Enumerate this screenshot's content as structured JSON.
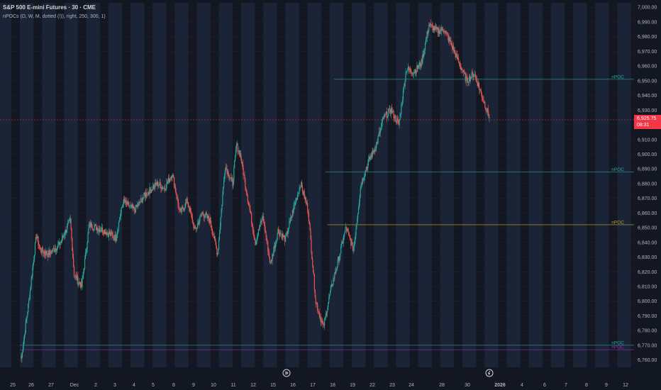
{
  "header": {
    "title": "S&P 500 E-mini Futures · 30 · CME",
    "indicator": "nPOCs (D, W, M, dotted (!)), right, 250, 300, 1)"
  },
  "price_tag": {
    "price": "6,925.75",
    "countdown": "08:31"
  },
  "colors": {
    "background": "#131722",
    "shade": "#1b2436",
    "up": "#26a69a",
    "down": "#ef5350",
    "grid": "#1e222d",
    "axis_text": "#b2b5be",
    "current_price": "#f23645",
    "npoc_daily": "#26a69a",
    "npoc_weekly": "#b0a030",
    "npoc_monthly": "#9c27b0"
  },
  "icons": [
    "replay-icon",
    "flash-icon"
  ],
  "chart_data": {
    "type": "candlestick",
    "title": "S&P 500 E-mini Futures · 30 · CME",
    "ylim": [
      6755,
      7003
    ],
    "y_ticks": [
      6760,
      6770,
      6780,
      6790,
      6800,
      6810,
      6820,
      6830,
      6840,
      6850,
      6860,
      6870,
      6880,
      6890,
      6900,
      6910,
      6920,
      6930,
      6940,
      6950,
      6960,
      6970,
      6980,
      6990,
      7000
    ],
    "y_tick_labels": [
      "6,760.00",
      "6,770.00",
      "6,780.00",
      "6,790.00",
      "6,800.00",
      "6,810.00",
      "6,820.00",
      "6,830.00",
      "6,840.00",
      "6,850.00",
      "6,860.00",
      "6,870.00",
      "6,880.00",
      "6,890.00",
      "6,900.00",
      "6,910.00",
      "6,920.00",
      "6,930.00",
      "6,940.00",
      "6,950.00",
      "6,960.00",
      "6,970.00",
      "6,980.00",
      "6,990.00",
      "7,000.00"
    ],
    "x_labels": [
      "25",
      "26",
      "27",
      "Dec",
      "2",
      "3",
      "4",
      "5",
      "8",
      "9",
      "10",
      "11",
      "12",
      "15",
      "16",
      "17",
      "18",
      "19",
      "22",
      "23",
      "24",
      "28",
      "30",
      "2026",
      "4",
      "6",
      "7",
      "8",
      "9",
      "12"
    ],
    "trading_days": 21,
    "current_price": 6925.75,
    "anchors": [
      [
        0,
        6761
      ],
      [
        2,
        6800
      ],
      [
        4,
        6845
      ],
      [
        5,
        6835
      ],
      [
        7,
        6832
      ],
      [
        10,
        6838
      ],
      [
        13,
        6855
      ],
      [
        14,
        6818
      ],
      [
        16,
        6810
      ],
      [
        18,
        6852
      ],
      [
        22,
        6848
      ],
      [
        25,
        6843
      ],
      [
        27,
        6868
      ],
      [
        30,
        6862
      ],
      [
        33,
        6873
      ],
      [
        36,
        6880
      ],
      [
        38,
        6877
      ],
      [
        40,
        6887
      ],
      [
        42,
        6860
      ],
      [
        44,
        6868
      ],
      [
        46,
        6848
      ],
      [
        48,
        6860
      ],
      [
        50,
        6855
      ],
      [
        52,
        6832
      ],
      [
        54,
        6892
      ],
      [
        56,
        6880
      ],
      [
        57,
        6906
      ],
      [
        58,
        6900
      ],
      [
        60,
        6870
      ],
      [
        62,
        6840
      ],
      [
        64,
        6858
      ],
      [
        66,
        6825
      ],
      [
        68,
        6848
      ],
      [
        70,
        6842
      ],
      [
        72,
        6862
      ],
      [
        74,
        6880
      ],
      [
        76,
        6862
      ],
      [
        78,
        6800
      ],
      [
        80,
        6782
      ],
      [
        82,
        6808
      ],
      [
        84,
        6828
      ],
      [
        86,
        6850
      ],
      [
        88,
        6835
      ],
      [
        90,
        6880
      ],
      [
        92,
        6895
      ],
      [
        94,
        6906
      ],
      [
        96,
        6925
      ],
      [
        98,
        6930
      ],
      [
        100,
        6920
      ],
      [
        102,
        6958
      ],
      [
        104,
        6956
      ],
      [
        106,
        6962
      ],
      [
        108,
        6988
      ],
      [
        110,
        6984
      ],
      [
        112,
        6985
      ],
      [
        114,
        6974
      ],
      [
        116,
        6962
      ],
      [
        118,
        6950
      ],
      [
        120,
        6955
      ],
      [
        122,
        6940
      ],
      [
        124,
        6925
      ]
    ],
    "npoc_lines": [
      {
        "label": "nPOC",
        "price": 6951,
        "from_day": 14.2,
        "type": "daily"
      },
      {
        "label": "nPOC",
        "price": 6888,
        "from_day": 13.8,
        "type": "daily"
      },
      {
        "label": "nPOC",
        "price": 6852,
        "from_day": 13.9,
        "type": "weekly"
      },
      {
        "label": "nPOC",
        "price": 6770,
        "from_day": 0.0,
        "type": "daily"
      },
      {
        "label": "nPOC",
        "price": 6767,
        "from_day": 0.0,
        "type": "monthly"
      }
    ]
  }
}
